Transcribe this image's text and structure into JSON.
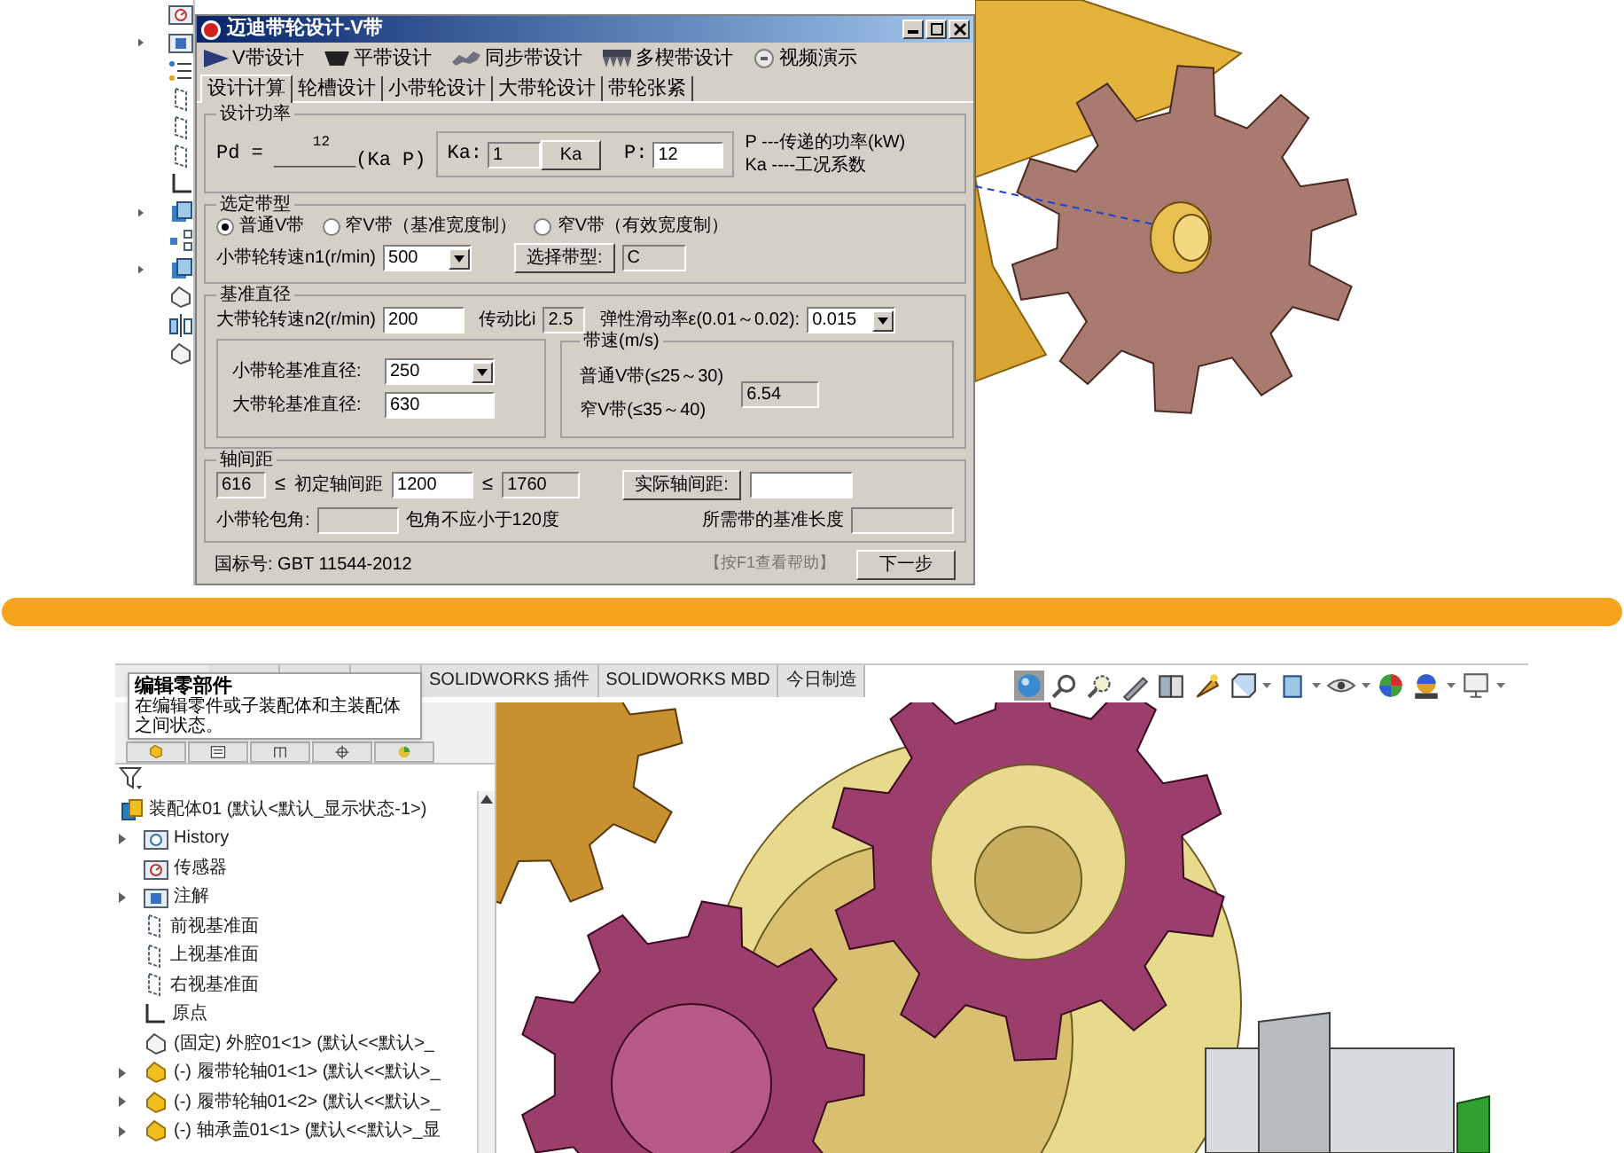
{
  "top_view": {
    "dialog": {
      "title": "迈迪带轮设计-V带",
      "toolbar": [
        {
          "label": "V带设计",
          "kind": "v-belt"
        },
        {
          "label": "平带设计",
          "kind": "flat-belt"
        },
        {
          "label": "同步带设计",
          "kind": "timing-belt"
        },
        {
          "label": "多楔带设计",
          "kind": "ribbed-belt"
        },
        {
          "label": "视频演示",
          "kind": "video"
        }
      ],
      "tabs": [
        {
          "label": "设计计算",
          "selected": true
        },
        {
          "label": "轮槽设计",
          "selected": false
        },
        {
          "label": "小带轮设计",
          "selected": false
        },
        {
          "label": "大带轮设计",
          "selected": false
        },
        {
          "label": "带轮张紧",
          "selected": false
        }
      ],
      "power_group": {
        "title": "设计功率",
        "formula_lhs": "Pd =",
        "numerator": "12",
        "formula_rest": "_______(Ka P)",
        "ka_label": "Ka:",
        "ka_value": "1",
        "ka_button": "Ka",
        "p_label": "P:",
        "p_value": "12",
        "notes": [
          "P ---传递的功率(kW)",
          "Ka ----工况系数"
        ]
      },
      "belt_type_group": {
        "title": "选定带型",
        "radios": [
          {
            "label": "普通V带",
            "selected": true
          },
          {
            "label": "窄V带（基准宽度制）",
            "selected": false
          },
          {
            "label": "窄V带（有效宽度制）",
            "selected": false
          }
        ],
        "speed_label": "小带轮转速n1(r/min)",
        "speed_value": "500",
        "select_button": "选择带型:",
        "belt_type_value": "C"
      },
      "diameter_group": {
        "title": "基准直径",
        "n2_label": "大带轮转速n2(r/min)",
        "n2_value": "200",
        "ratio_label": "传动比i",
        "ratio_value": "2.5",
        "slip_label": "弹性滑动率ε(0.01～0.02):",
        "slip_value": "0.015",
        "small_label": "小带轮基准直径:",
        "small_value": "250",
        "large_label": "大带轮基准直径:",
        "large_value": "630",
        "speed_box": {
          "title": "带速(m/s)",
          "lines": [
            "普通V带(≤25～30)",
            "窄V带(≤35～40)"
          ],
          "value": "6.54"
        }
      },
      "center_group": {
        "title": "轴间距",
        "min_value": "616",
        "lt_1": "≤",
        "label": "初定轴间距",
        "value": "1200",
        "lt_2": "≤",
        "max_value": "1760",
        "button": "实际轴间距:",
        "wrap_label": "小带轮包角:",
        "wrap_note": "包角不应小于120度",
        "length_label": "所需带的基准长度"
      },
      "footer": {
        "standard": "国标号: GBT 11544-2012",
        "help": "【按F1查看帮助】",
        "next_button": "下一步"
      }
    }
  },
  "bottom_view": {
    "tabs": [
      {
        "label": "SOLIDWORKS 插件"
      },
      {
        "label": "SOLIDWORKS MBD"
      },
      {
        "label": "今日制造"
      }
    ],
    "tooltip": {
      "title": "编辑零部件",
      "body": "在编辑零件或子装配体和主装配体之间状态。"
    },
    "tree": {
      "label": "装配体01 (默认<默认_显示状态-1>)",
      "kind": "assembly",
      "children": [
        {
          "label": "History",
          "kind": "history",
          "expandable": true
        },
        {
          "label": "传感器",
          "kind": "sensor",
          "expandable": false
        },
        {
          "label": "注解",
          "kind": "annotation",
          "expandable": true
        },
        {
          "label": "前视基准面",
          "kind": "plane",
          "expandable": false
        },
        {
          "label": "上视基准面",
          "kind": "plane",
          "expandable": false
        },
        {
          "label": "右视基准面",
          "kind": "plane",
          "expandable": false
        },
        {
          "label": "原点",
          "kind": "origin",
          "expandable": false
        },
        {
          "label": "(固定) 外腔01<1> (默认<<默认>_",
          "kind": "fixed-part",
          "expandable": false
        },
        {
          "label": "(-) 履带轮轴01<1> (默认<<默认>_",
          "kind": "part",
          "expandable": true
        },
        {
          "label": "(-) 履带轮轴01<2> (默认<<默认>_",
          "kind": "part",
          "expandable": true
        },
        {
          "label": "(-) 轴承盖01<1> (默认<<默认>_显",
          "kind": "part",
          "expandable": true
        }
      ]
    }
  }
}
